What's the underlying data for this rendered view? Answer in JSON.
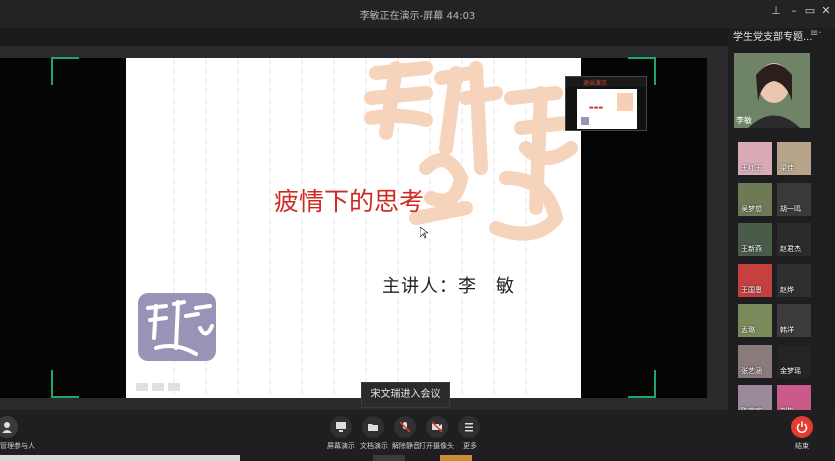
{
  "window": {
    "title": "李敏正在演示-屏幕 44:03"
  },
  "slide": {
    "title": "疲情下的思考",
    "presenter_line": "主讲人：李　敏"
  },
  "mini_preview": {
    "label": "退出演示"
  },
  "toast": "宋文瑞进入会议",
  "panel": {
    "title": "学生党支部专题...",
    "main_speaker": "李敏",
    "participants": [
      {
        "name": "王红玉",
        "bg": "#d9a9b6"
      },
      {
        "name": "梁佳",
        "bg": "#b7a48a"
      },
      {
        "name": "吴梦想",
        "bg": "#6d7a55"
      },
      {
        "name": "胡一鸣",
        "bg": "#3a3a3a"
      },
      {
        "name": "王新燕",
        "bg": "#4a5b4a"
      },
      {
        "name": "赵君杰",
        "bg": "#2b2b2b"
      },
      {
        "name": "王国恩",
        "bg": "#c74040"
      },
      {
        "name": "赵烨",
        "bg": "#2f2f2f"
      },
      {
        "name": "孟璐",
        "bg": "#7a8a5a"
      },
      {
        "name": "韩洋",
        "bg": "#3c3c3c"
      },
      {
        "name": "张艺涵",
        "bg": "#8a7a7a"
      },
      {
        "name": "金梦瑶",
        "bg": "#242424"
      },
      {
        "name": "陈欢欢",
        "bg": "#9a8a9a"
      },
      {
        "name": "刘彬",
        "bg": "#c95a8a"
      }
    ]
  },
  "toolbar": {
    "participants_label": "管理参与人",
    "share_screen": "屏幕演示",
    "share_doc": "文档演示",
    "unmute": "解除静音",
    "camera": "打开摄像头",
    "more": "更多",
    "end": "结束"
  },
  "colors": {
    "accent_green": "#1fa66a",
    "end_red": "#e53a31",
    "slide_title_red": "#d02a20"
  }
}
